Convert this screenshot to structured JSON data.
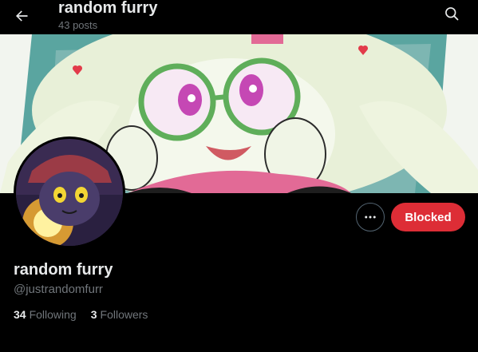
{
  "header": {
    "title": "random furry",
    "post_count": "43 posts"
  },
  "profile": {
    "display_name": "random furry",
    "handle": "@justrandomfurr",
    "following_count": "34",
    "following_label": "Following",
    "followers_count": "3",
    "followers_label": "Followers"
  },
  "actions": {
    "blocked_label": "Blocked"
  },
  "colors": {
    "background": "#000000",
    "blocked_button": "#dd2d36",
    "secondary_text": "#71767b",
    "primary_text": "#e7e9ea"
  },
  "icons": {
    "back": "arrow-left-icon",
    "search": "search-icon",
    "more": "more-horizontal-icon"
  }
}
